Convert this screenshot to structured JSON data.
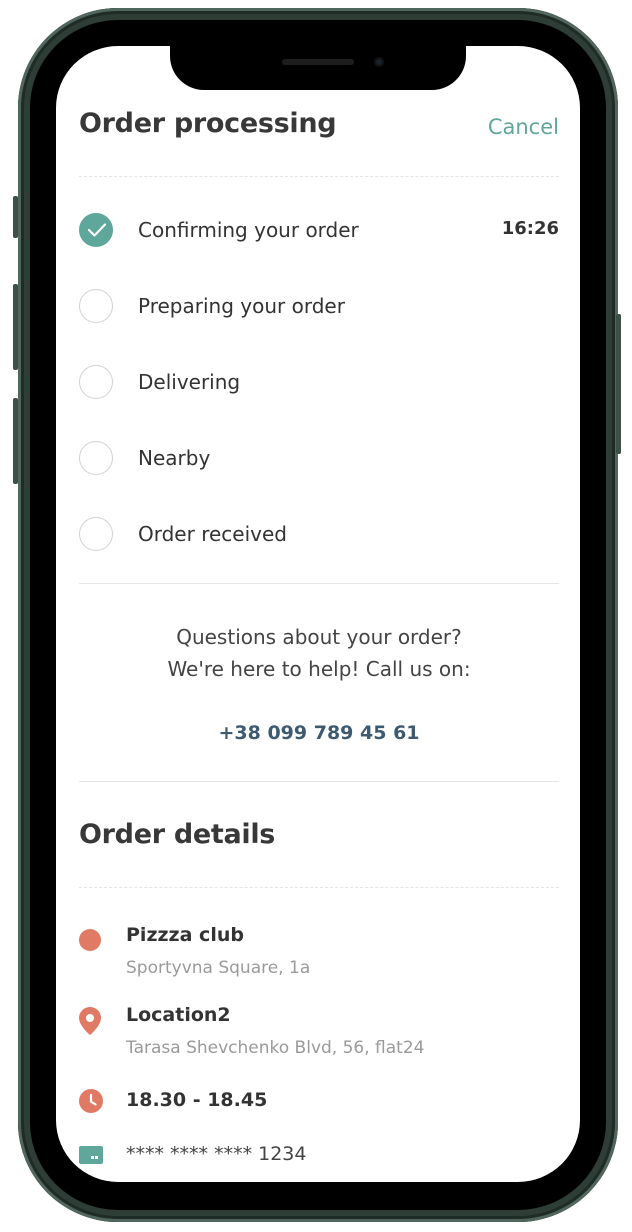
{
  "header": {
    "title": "Order processing",
    "cancel_label": "Cancel"
  },
  "statuses": [
    {
      "label": "Confirming your order",
      "done": true,
      "time": "16:26"
    },
    {
      "label": "Preparing your order",
      "done": false
    },
    {
      "label": "Delivering",
      "done": false
    },
    {
      "label": "Nearby",
      "done": false
    },
    {
      "label": "Order received",
      "done": false
    }
  ],
  "help": {
    "line1": "Questions about your order?",
    "line2": "We're here to help! Call us on:",
    "phone": "+38 099 789 45 61"
  },
  "details": {
    "title": "Order details",
    "restaurant_name": "Pizzza club",
    "restaurant_address": "Sportyvna Square, 1a",
    "location_name": "Location2",
    "location_address": "Tarasa Shevchenko Blvd, 56, flat24",
    "delivery_time": "18.30 - 18.45",
    "card_number": "**** **** **** 1234"
  },
  "colors": {
    "accent": "#5ea79a",
    "icon": "#e07a64",
    "phone_link": "#3e5a70"
  }
}
